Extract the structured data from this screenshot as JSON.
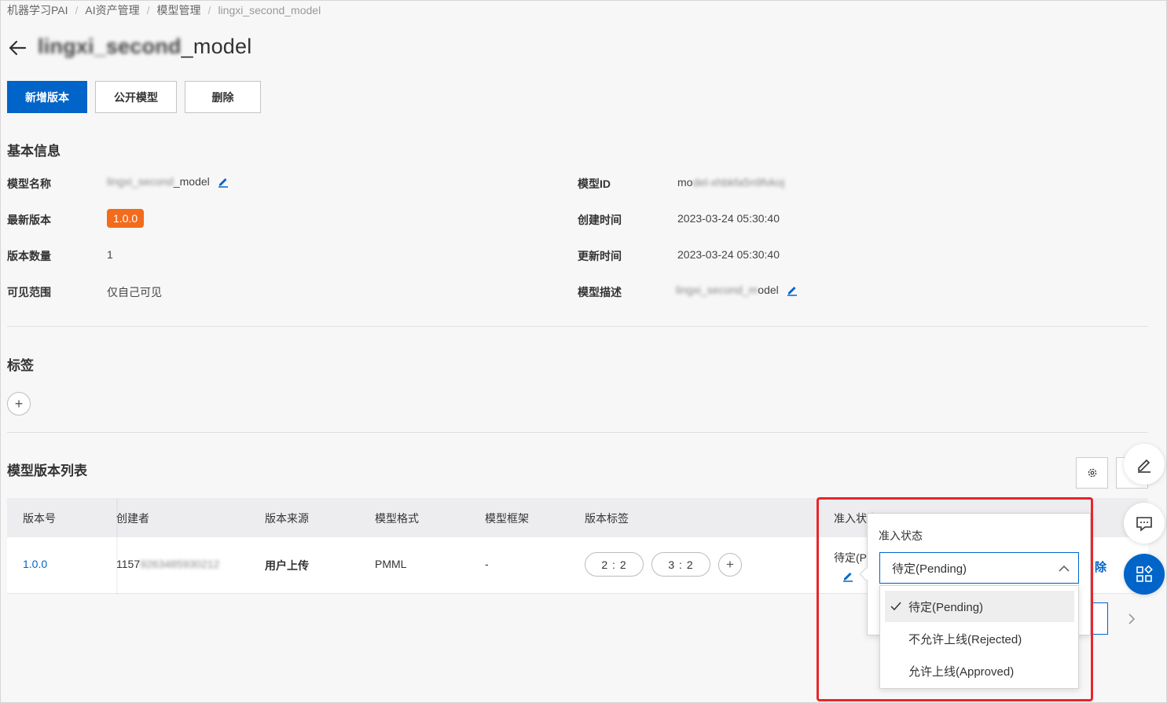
{
  "breadcrumb": {
    "items": [
      "机器学习PAI",
      "AI资产管理",
      "模型管理"
    ],
    "current": "lingxi_second_model",
    "separator": "/"
  },
  "title": {
    "blurred": "lingxi_second",
    "suffix": "_model"
  },
  "toolbar": {
    "new_version": "新增版本",
    "publish": "公开模型",
    "delete": "删除"
  },
  "basic_info": {
    "section_title": "基本信息",
    "model_name_label": "模型名称",
    "model_name_blur": "lingxi_second",
    "model_name_suffix": "_model",
    "latest_version_label": "最新版本",
    "latest_version": "1.0.0",
    "version_count_label": "版本数量",
    "version_count": "1",
    "visibility_label": "可见范围",
    "visibility": "仅自己可见",
    "model_id_label": "模型ID",
    "model_id_prefix": "mo",
    "model_id_blur": "del-xhbkfa5n9fvkoj",
    "created_label": "创建时间",
    "created": "2023-03-24 05:30:40",
    "updated_label": "更新时间",
    "updated": "2023-03-24 05:30:40",
    "desc_label": "模型描述",
    "desc_blur": "lingxi_second_m",
    "desc_suffix": "odel"
  },
  "tags": {
    "section_title": "标签",
    "add": "+"
  },
  "versions": {
    "section_title": "模型版本列表",
    "columns": [
      "版本号",
      "创建者",
      "版本来源",
      "模型格式",
      "模型框架",
      "版本标签",
      "准入状态"
    ],
    "row": {
      "version": "1.0.0",
      "creator_prefix": "1157",
      "creator_blur": "9263485930212",
      "source": "用户上传",
      "format": "PMML",
      "framework": "-",
      "tags": [
        "2 : 2",
        "3 : 2"
      ],
      "add_tag": "+",
      "status_partial": "待定(P",
      "delete_partial": "除"
    }
  },
  "popover": {
    "title": "准入状态",
    "selected": "待定(Pending)",
    "options": [
      "待定(Pending)",
      "不允许上线(Rejected)",
      "允许上线(Approved)"
    ]
  },
  "colors": {
    "primary": "#0064c8",
    "badge": "#f36b1c",
    "highlight": "#e8262a"
  }
}
